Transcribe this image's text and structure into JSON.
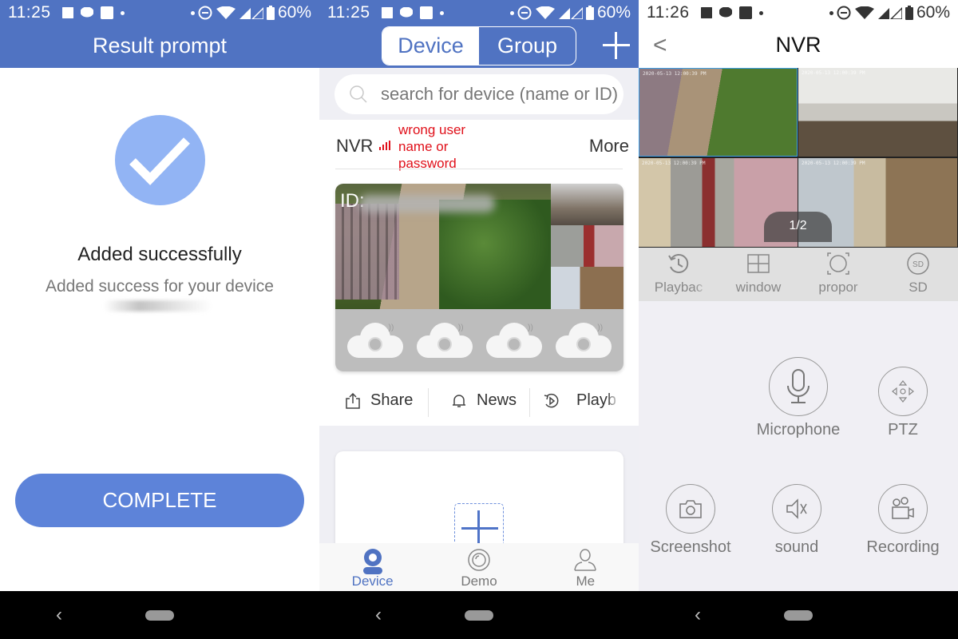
{
  "status_bars": [
    {
      "time": "11:25",
      "battery": "60%"
    },
    {
      "time": "11:25",
      "battery": "60%"
    },
    {
      "time": "11:26",
      "battery": "60%"
    }
  ],
  "result_screen": {
    "title": "Result prompt",
    "icon": "check-circle-icon",
    "message": "Added successfully",
    "submessage": "Added success for your device",
    "complete_label": "COMPLETE",
    "accent_color": "#5d83d9"
  },
  "device_screen": {
    "segments": [
      {
        "label": "Device",
        "active": true
      },
      {
        "label": "Group",
        "active": false
      }
    ],
    "search_placeholder": "search for device (name or ID)",
    "device": {
      "name": "NVR",
      "error": "wrong user name or password",
      "more_label": "More",
      "id_label": "ID:"
    },
    "actions": [
      {
        "icon": "share-icon",
        "label": "Share"
      },
      {
        "icon": "bell-icon",
        "label": "News"
      },
      {
        "icon": "playback-icon",
        "label": "Playb"
      }
    ],
    "tabs": [
      {
        "icon": "camera-icon",
        "label": "Device",
        "active": true
      },
      {
        "icon": "lens-icon",
        "label": "Demo",
        "active": false
      },
      {
        "icon": "person-icon",
        "label": "Me",
        "active": false
      }
    ],
    "error_color": "#e0101a",
    "brand_color": "#5073c2"
  },
  "nvr_screen": {
    "title": "NVR",
    "page_indicator": "1/2",
    "timestamp_overlay": "2020-05-13 12:00:39 PM",
    "tools": [
      {
        "icon": "history-icon",
        "label": "Playbac"
      },
      {
        "icon": "grid-icon",
        "label": "window"
      },
      {
        "icon": "aspect-ratio-icon",
        "label": "propor"
      },
      {
        "icon": "sd-icon",
        "label": "SD"
      }
    ],
    "controls": [
      {
        "icon": "microphone-icon",
        "label": "Microphone"
      },
      {
        "icon": "ptz-icon",
        "label": "PTZ"
      },
      {
        "icon": "camera-icon",
        "label": "Screenshot"
      },
      {
        "icon": "speaker-mute-icon",
        "label": "sound"
      },
      {
        "icon": "video-camera-icon",
        "label": "Recording"
      }
    ]
  }
}
